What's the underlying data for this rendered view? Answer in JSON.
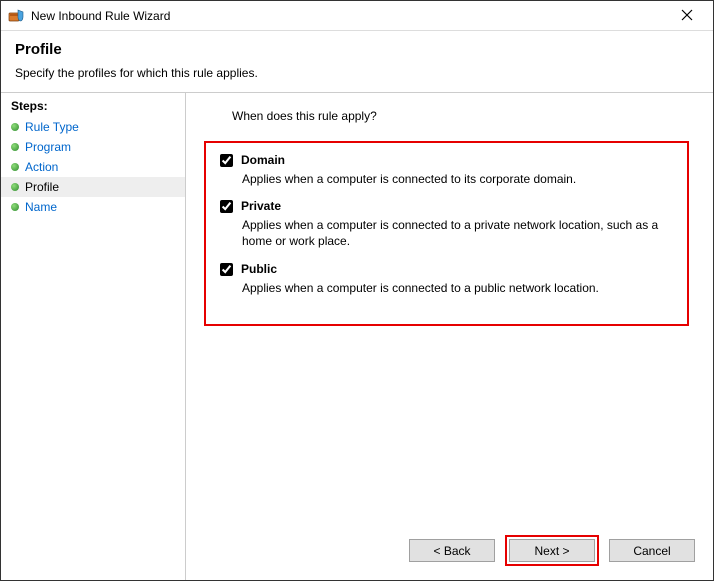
{
  "window": {
    "title": "New Inbound Rule Wizard"
  },
  "header": {
    "title": "Profile",
    "subtitle": "Specify the profiles for which this rule applies."
  },
  "sidebar": {
    "title": "Steps:",
    "items": [
      {
        "label": "Rule Type",
        "active": false
      },
      {
        "label": "Program",
        "active": false
      },
      {
        "label": "Action",
        "active": false
      },
      {
        "label": "Profile",
        "active": true
      },
      {
        "label": "Name",
        "active": false
      }
    ]
  },
  "main": {
    "prompt": "When does this rule apply?",
    "options": [
      {
        "label": "Domain",
        "checked": true,
        "description": "Applies when a computer is connected to its corporate domain."
      },
      {
        "label": "Private",
        "checked": true,
        "description": "Applies when a computer is connected to a private network location, such as a home or work place."
      },
      {
        "label": "Public",
        "checked": true,
        "description": "Applies when a computer is connected to a public network location."
      }
    ]
  },
  "buttons": {
    "back": "< Back",
    "next": "Next >",
    "cancel": "Cancel"
  }
}
